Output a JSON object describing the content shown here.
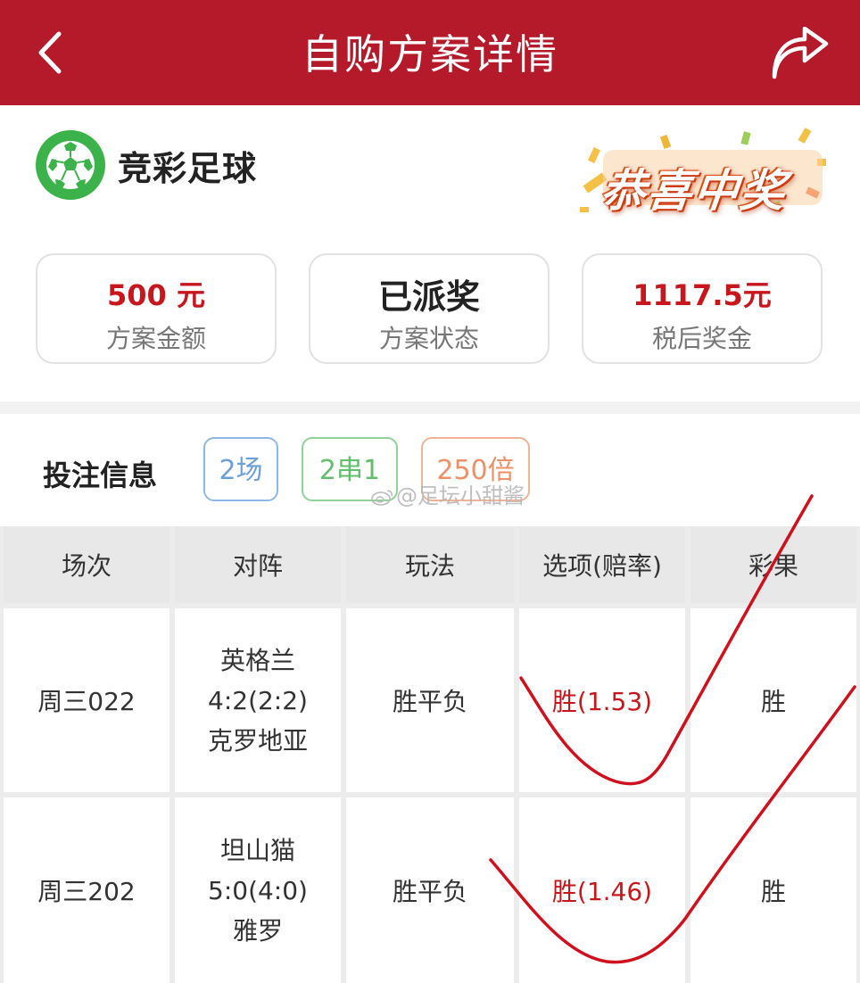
{
  "header": {
    "title": "自购方案详情",
    "back_icon": "chevron-left-icon",
    "share_icon": "share-arrow-icon"
  },
  "lottery": {
    "icon": "soccer-ball-icon",
    "name": "竞彩足球",
    "win_badge": "恭喜中奖"
  },
  "summary": {
    "amount_value": "500 元",
    "amount_label": "方案金额",
    "status_value": "已派奖",
    "status_label": "方案状态",
    "prize_value": "1117.5元",
    "prize_label": "税后奖金"
  },
  "bet": {
    "title": "投注信息",
    "matches_tag": "2场",
    "parlay_tag": "2串1",
    "multiple_tag": "250倍",
    "watermark": "@足坛小甜酱"
  },
  "table": {
    "headers": [
      "场次",
      "对阵",
      "玩法",
      "选项(赔率)",
      "彩果"
    ],
    "rows": [
      {
        "match_no": "周三022",
        "home": "英格兰",
        "score": "4:2(2:2)",
        "away": "克罗地亚",
        "play": "胜平负",
        "pick": "胜(1.53)",
        "result": "胜"
      },
      {
        "match_no": "周三202",
        "home": "坦山猫",
        "score": "5:0(4:0)",
        "away": "雅罗",
        "play": "胜平负",
        "pick": "胜(1.46)",
        "result": "胜"
      }
    ]
  },
  "colors": {
    "header_bg": "#b41a2a",
    "accent_red": "#c8161d",
    "ball_green": "#3bb34a",
    "tag_blue": "#6d9fd9",
    "tag_green": "#62bf6c",
    "tag_orange": "#ec9168",
    "check_mark_red": "#d0101c"
  }
}
